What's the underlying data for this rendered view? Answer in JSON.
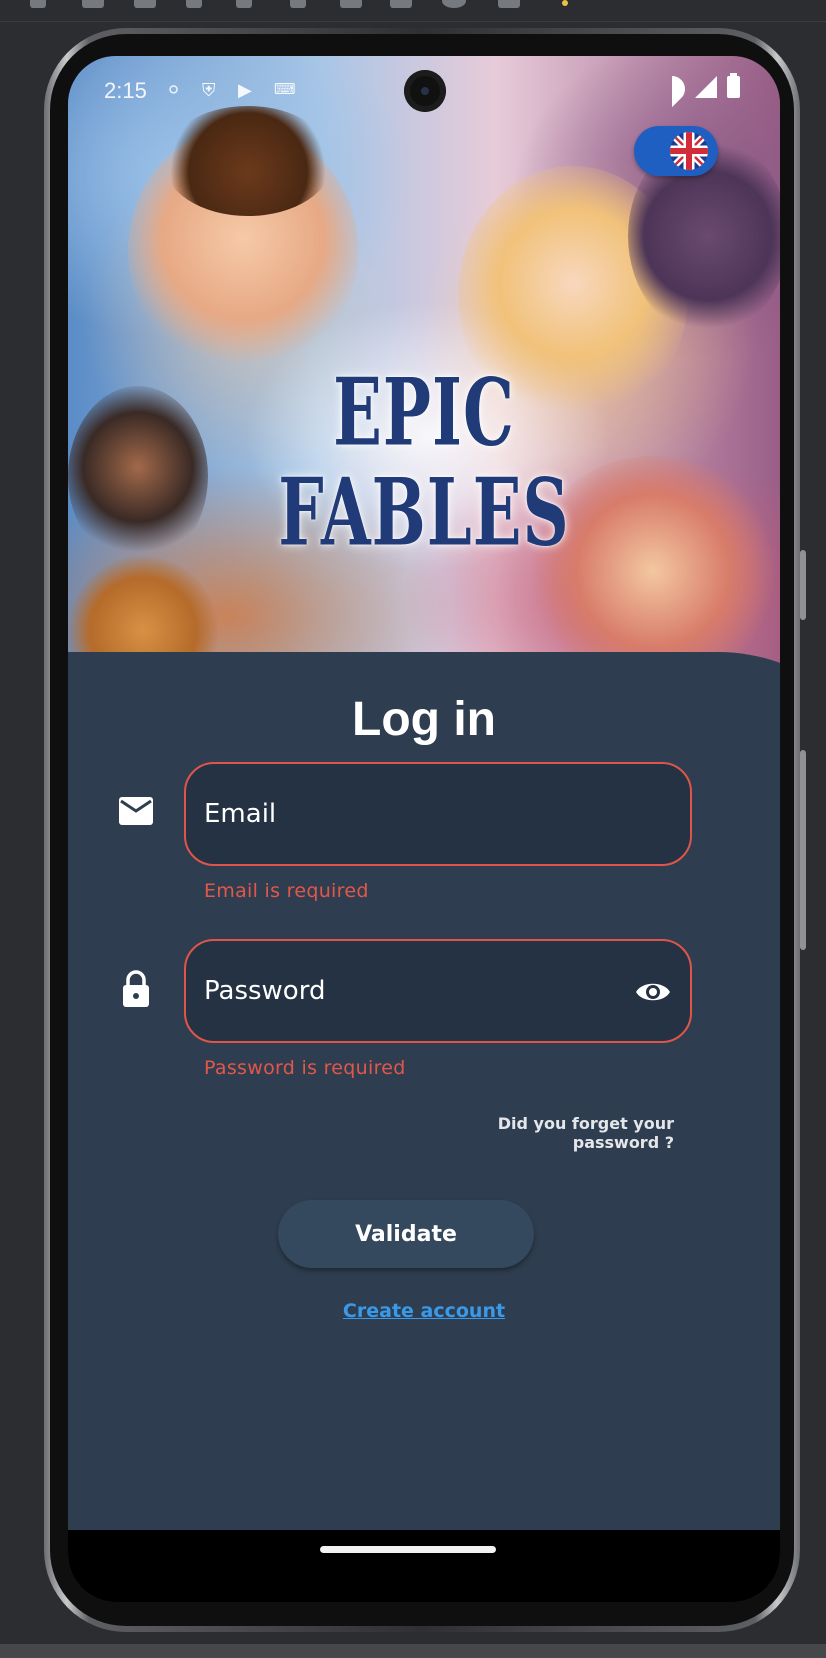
{
  "status_bar": {
    "time": "2:15"
  },
  "hero": {
    "title_line1": "EPIC",
    "title_line2": "FABLES"
  },
  "language": {
    "current": "flag-uk-icon"
  },
  "login": {
    "title": "Log in",
    "email_placeholder": "Email",
    "email_error": "Email is required",
    "password_placeholder": "Password",
    "password_error": "Password is required",
    "forgot_password": "Did you forget your password ?",
    "validate_label": "Validate",
    "create_account": "Create account"
  },
  "colors": {
    "background": "#2e3e50",
    "field_fill": "#243244",
    "error": "#e3574a",
    "link": "#3a9aea",
    "toggle": "#1f5fc2"
  }
}
